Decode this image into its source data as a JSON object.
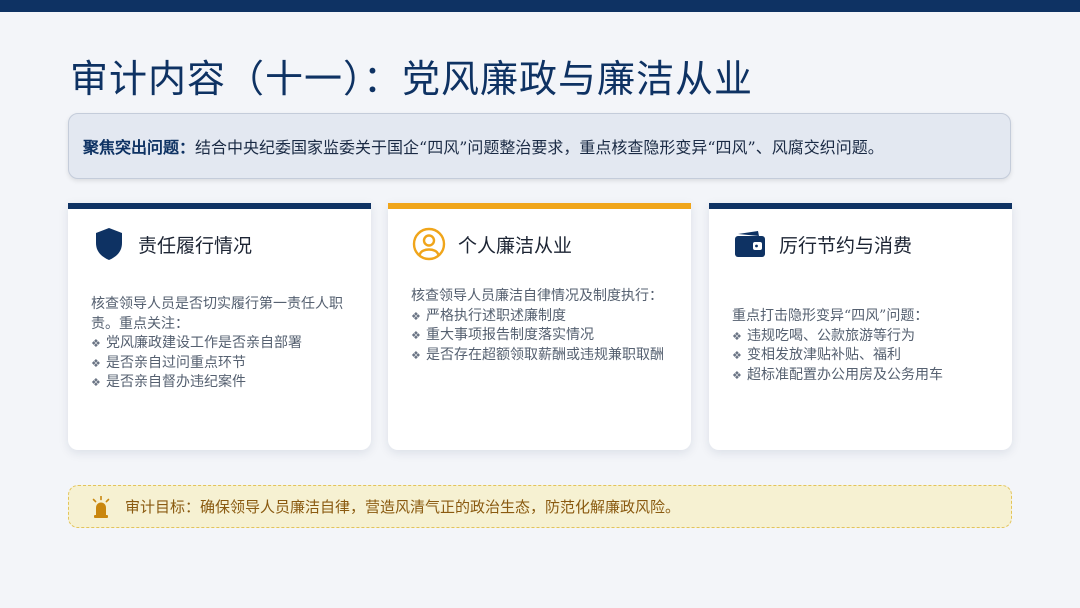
{
  "slide": {
    "title": "审计内容（十一）：党风廉政与廉洁从业",
    "colors": {
      "navy": "#0e3263",
      "accent_orange": "#f0a51a",
      "goal_text": "#8a5a10"
    }
  },
  "focus": {
    "lead": "聚焦突出问题：",
    "text": "结合中央纪委国家监委关于国企“四风”问题整治要求，重点核查隐形变异“四风”、风腐交织问题。"
  },
  "cards": [
    {
      "icon": "shield-icon",
      "title": "责任履行情况",
      "intro": "核查领导人员是否切实履行第一责任人职责。重点关注：",
      "bullet_symbol": "❖",
      "items": [
        "党风廉政建设工作是否亲自部署",
        "是否亲自过问重点环节",
        "是否亲自督办违纪案件"
      ]
    },
    {
      "icon": "user-circle-icon",
      "title": "个人廉洁从业",
      "intro": "核查领导人员廉洁自律情况及制度执行：",
      "bullet_symbol": "❖",
      "items": [
        "严格执行述职述廉制度",
        "重大事项报告制度落实情况",
        "是否存在超额领取薪酬或违规兼职取酬"
      ]
    },
    {
      "icon": "wallet-icon",
      "title": "厉行节约与消费",
      "intro": "重点打击隐形变异“四风”问题：",
      "bullet_symbol": "❖",
      "items": [
        "违规吃喝、公款旅游等行为",
        "变相发放津贴补贴、福利",
        "超标准配置办公用房及公务用车"
      ]
    }
  ],
  "goal": {
    "icon": "alarm-light-icon",
    "text": "审计目标：确保领导人员廉洁自律，营造风清气正的政治生态，防范化解廉政风险。"
  }
}
